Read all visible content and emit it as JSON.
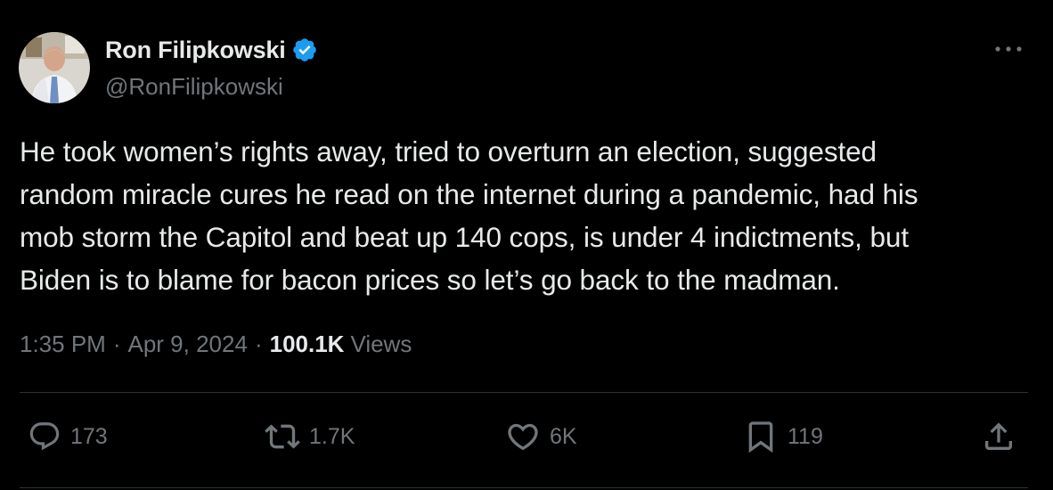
{
  "author": {
    "display_name": "Ron Filipkowski",
    "handle": "@RonFilipkowski",
    "verified": true
  },
  "tweet": {
    "text": "He took women’s rights away, tried to overturn an election, suggested\nrandom miracle cures he read on the internet during a pandemic, had his\nmob storm the Capitol and beat up 140 cops, is under 4 indictments, but\nBiden is to blame for bacon prices so let’s go back to the madman.",
    "time": "1:35 PM",
    "date": "Apr 9, 2024",
    "separator": "·",
    "views_count": "100.1K",
    "views_label": "Views"
  },
  "actions": {
    "replies": "173",
    "reposts": "1.7K",
    "likes": "6K",
    "bookmarks": "119"
  },
  "colors": {
    "background": "#000000",
    "text_primary": "#e7e9ea",
    "text_secondary": "#71767b",
    "verified_badge": "#1d9bf0",
    "divider": "#2f3336"
  },
  "icons": {
    "more": "more-horizontal-icon",
    "verified": "verified-badge-icon",
    "reply": "reply-icon",
    "repost": "repost-icon",
    "like": "heart-icon",
    "bookmark": "bookmark-icon",
    "share": "share-icon"
  }
}
